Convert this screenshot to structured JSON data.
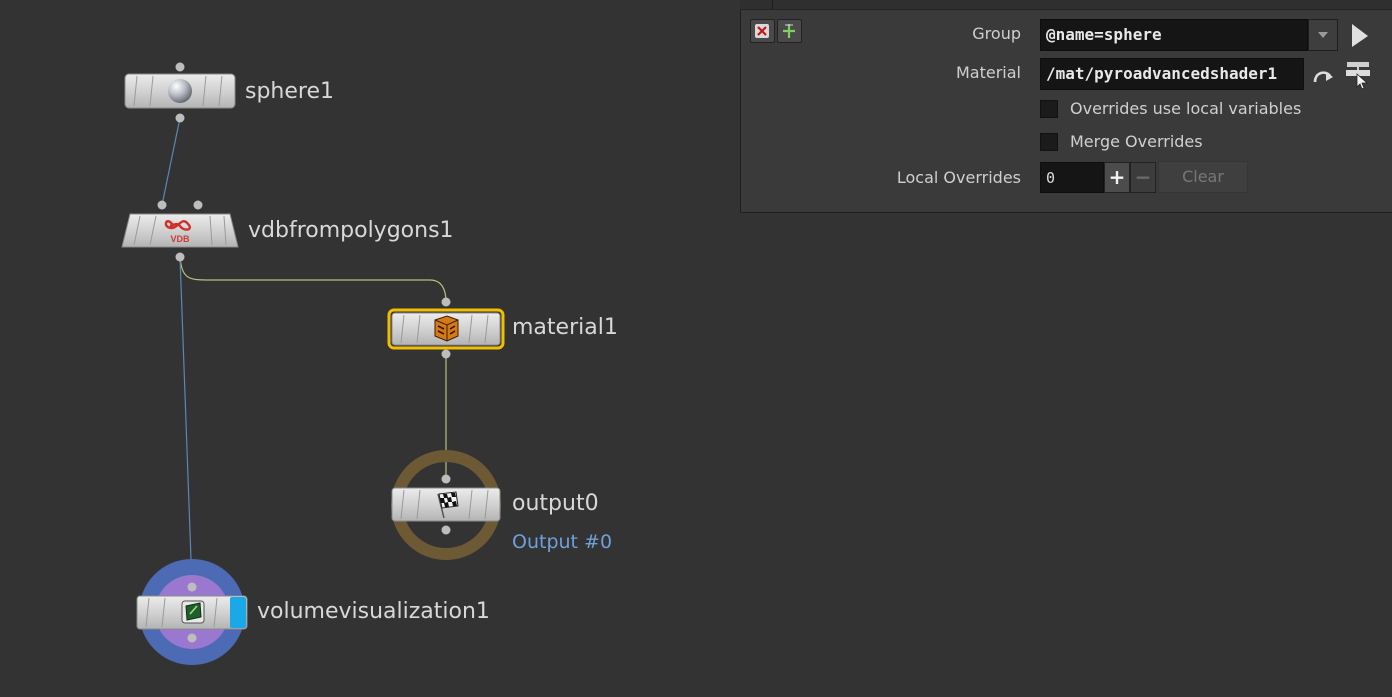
{
  "network": {
    "nodes": {
      "sphere": {
        "name": "sphere1"
      },
      "vdb": {
        "name": "vdbfrompolygons1",
        "icon_text": "VDB"
      },
      "material": {
        "name": "material1"
      },
      "output": {
        "name": "output0",
        "sublabel": "Output #0"
      },
      "volvis": {
        "name": "volumevisualization1"
      }
    }
  },
  "parms": {
    "group": {
      "label": "Group",
      "value": "@name=sphere"
    },
    "material": {
      "label": "Material",
      "value": "/mat/pyroadvancedshader1"
    },
    "overrides_local": {
      "label": "Overrides use local variables",
      "checked": false
    },
    "merge_overrides": {
      "label": "Merge Overrides",
      "checked": false
    },
    "local_overrides": {
      "label": "Local Overrides",
      "value": "0",
      "plus": "+",
      "minus": "−",
      "clear": "Clear"
    }
  },
  "colors": {
    "background": "#333333",
    "selected_node": "#f0c000",
    "wire_blue": "#5b86b8",
    "wire_yellow": "#b8c07a",
    "output_ring": "#6d5a35",
    "display_flag": "#1aa8e8",
    "volvis_ring": "#4d6ab4",
    "volvis_inner": "#9a78cf"
  }
}
